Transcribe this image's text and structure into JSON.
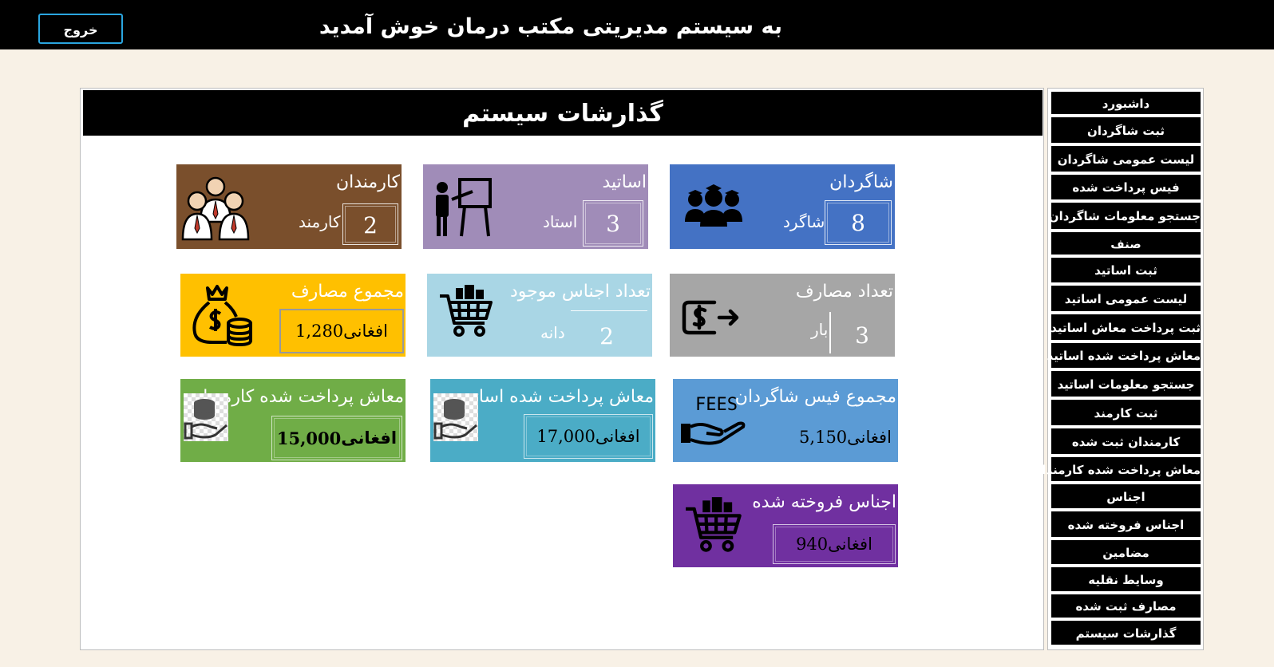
{
  "header": {
    "welcome": "به سیستم مدیریتی  مکتب درمان خوش آمدید",
    "exit_label": "خروج"
  },
  "panel": {
    "title": "گذارشات سیستم"
  },
  "sidebar": {
    "items": [
      {
        "label": "داشبورد"
      },
      {
        "label": "ثبت شاگردان"
      },
      {
        "label": "لیست عمومی شاگردان"
      },
      {
        "label": "فیس پرداخت شده"
      },
      {
        "label": "جستجو معلومات شاگردان"
      },
      {
        "label": "صنف"
      },
      {
        "label": "ثبت اساتید"
      },
      {
        "label": "لیست عمومی اساتید"
      },
      {
        "label": "ثبت پرداخت معاش اساتید"
      },
      {
        "label": "معاش پرداخت شده اساتید"
      },
      {
        "label": "جستجو معلومات اساتید"
      },
      {
        "label": "ثبت کارمند"
      },
      {
        "label": "کارمندان ثبت شده"
      },
      {
        "label": "معاش پرداخت شده کارمندان"
      },
      {
        "label": "اجناس"
      },
      {
        "label": "اجناس فروخته شده"
      },
      {
        "label": "مضامین"
      },
      {
        "label": "وسایط نقلیه"
      },
      {
        "label": "مصارف ثبت شده"
      },
      {
        "label": "گذارشات سیستم"
      }
    ]
  },
  "tiles": {
    "students": {
      "title": "شاگردان",
      "value": "8",
      "unit": "شاگرد",
      "color": "#4472c4",
      "icon": "students-group-icon"
    },
    "teachers": {
      "title": "اساتید",
      "value": "3",
      "unit": "استاد",
      "color": "#a08cb8",
      "icon": "teacher-board-icon"
    },
    "employees": {
      "title": "کارمندان",
      "value": "2",
      "unit": "کارمند",
      "color": "#7a4f2c",
      "icon": "employees-icon"
    },
    "expense_count": {
      "title": "تعداد مصارف",
      "value": "3",
      "unit": "بار",
      "color": "#a6a6a6",
      "icon": "dollar-out-icon"
    },
    "stock_count": {
      "title": "تعداد اجناس موجود",
      "value": "2",
      "unit": "دانه",
      "color": "#a9d6e5",
      "icon": "shopping-cart-icon"
    },
    "expense_total": {
      "title": "مجموع مصارف",
      "amount": "1,280",
      "currency": "افغانی",
      "color": "#ffc000",
      "icon": "money-bag-icon"
    },
    "fees_total": {
      "title": "مجموع فیس شاگردان",
      "amount": "5,150",
      "currency": "افغانی",
      "color": "#5b9bd5",
      "icon": "fees-hand-icon",
      "icon_text": "FEES"
    },
    "teacher_salary": {
      "title": "معاش پرداخت شده اساتید",
      "amount": "17,000",
      "currency": "افغانی",
      "color": "#4bacc6",
      "icon": "coins-hand-icon"
    },
    "employee_salary": {
      "title": "معاش پرداخت شده کارمندان",
      "amount": "15,000",
      "currency": "افغانی",
      "color": "#70ad47",
      "icon": "coins-hand-icon"
    },
    "sold_goods": {
      "title": "اجناس فروخته شده",
      "amount": "940",
      "currency": "افغانی",
      "color": "#7030a0",
      "icon": "shopping-cart-icon"
    }
  }
}
